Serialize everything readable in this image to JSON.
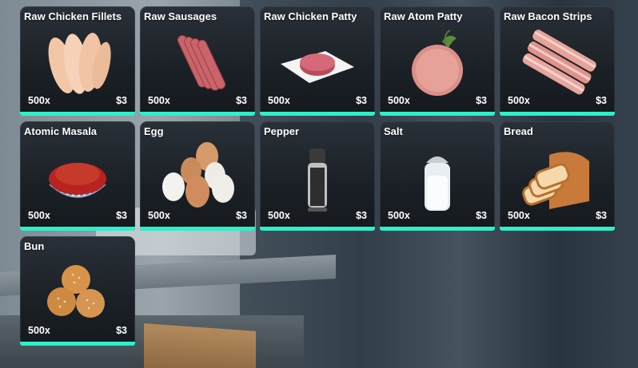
{
  "accent_color": "#2ef0c8",
  "items": [
    {
      "name": "Raw Chicken Fillets",
      "qty": "500x",
      "price": "$3",
      "icon": "chicken-fillets-icon"
    },
    {
      "name": "Raw Sausages",
      "qty": "500x",
      "price": "$3",
      "icon": "sausages-icon"
    },
    {
      "name": "Raw Chicken Patty",
      "qty": "500x",
      "price": "$3",
      "icon": "chicken-patty-icon"
    },
    {
      "name": "Raw Atom Patty",
      "qty": "500x",
      "price": "$3",
      "icon": "atom-patty-icon"
    },
    {
      "name": "Raw Bacon Strips",
      "qty": "500x",
      "price": "$3",
      "icon": "bacon-strips-icon"
    },
    {
      "name": "Atomic Masala",
      "qty": "500x",
      "price": "$3",
      "icon": "masala-bowl-icon"
    },
    {
      "name": "Egg",
      "qty": "500x",
      "price": "$3",
      "icon": "eggs-icon"
    },
    {
      "name": "Pepper",
      "qty": "500x",
      "price": "$3",
      "icon": "pepper-grinder-icon"
    },
    {
      "name": "Salt",
      "qty": "500x",
      "price": "$3",
      "icon": "salt-shaker-icon"
    },
    {
      "name": "Bread",
      "qty": "500x",
      "price": "$3",
      "icon": "bread-loaf-icon"
    },
    {
      "name": "Bun",
      "qty": "500x",
      "price": "$3",
      "icon": "buns-icon"
    }
  ]
}
